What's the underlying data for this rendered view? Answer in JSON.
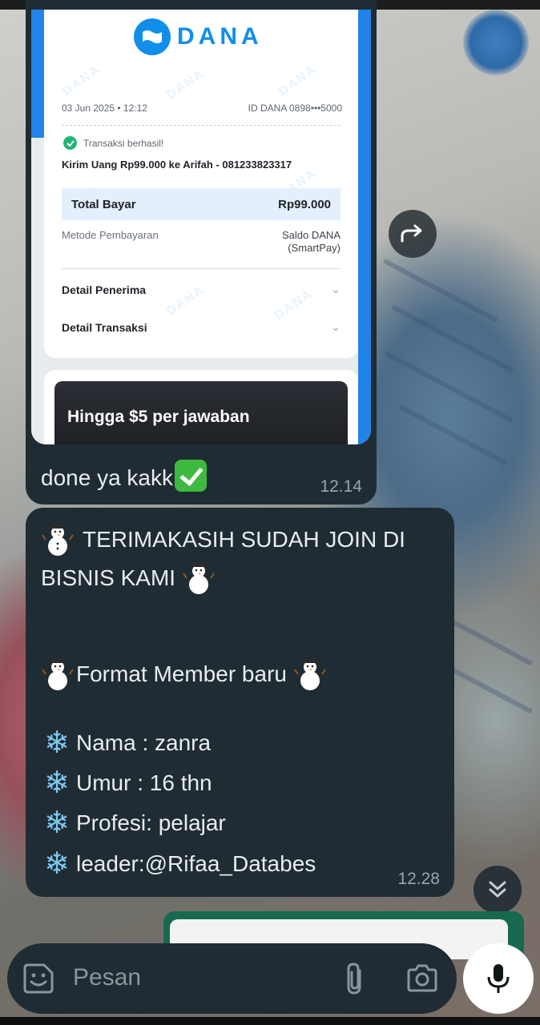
{
  "receipt": {
    "brand": "DANA",
    "watermark": "DANA",
    "date": "03 Jun 2025 • 12:12",
    "dana_id": "ID DANA 0898•••5000",
    "status": "Transaksi berhasil!",
    "description": "Kirim Uang Rp99.000 ke Arifah - 081233823317",
    "total_label": "Total Bayar",
    "total_value": "Rp99.000",
    "method_label": "Metode Pembayaran",
    "method_value_1": "Saldo DANA",
    "method_value_2": "(SmartPay)",
    "row_recipient": "Detail Penerima",
    "row_transaction": "Detail Transaksi",
    "promo": "Hingga $5 per jawaban"
  },
  "messages": {
    "m1": {
      "text": "done ya kakk",
      "time": "12.14"
    },
    "m2": {
      "line1": "TERIMAKASIH SUDAH JOIN DI",
      "line2": "BISNIS KAMI",
      "line3": "Format Member baru",
      "name": "Nama : zanra",
      "age": "Umur : 16 thn",
      "job": "Profesi: pelajar",
      "leader": "leader:@Rifaa_Databes",
      "time": "12.28"
    }
  },
  "composer": {
    "placeholder": "Pesan"
  },
  "icons": {
    "forward": "forward-icon",
    "scroll_down": "double-chevron-down-icon",
    "sticker": "sticker-icon",
    "attach": "paperclip-icon",
    "camera": "camera-icon",
    "mic": "microphone-icon"
  },
  "colors": {
    "bubble": "#1f2c33",
    "dana_blue": "#118eea",
    "success_green": "#22b573",
    "timestamp": "#9aa4aa"
  }
}
